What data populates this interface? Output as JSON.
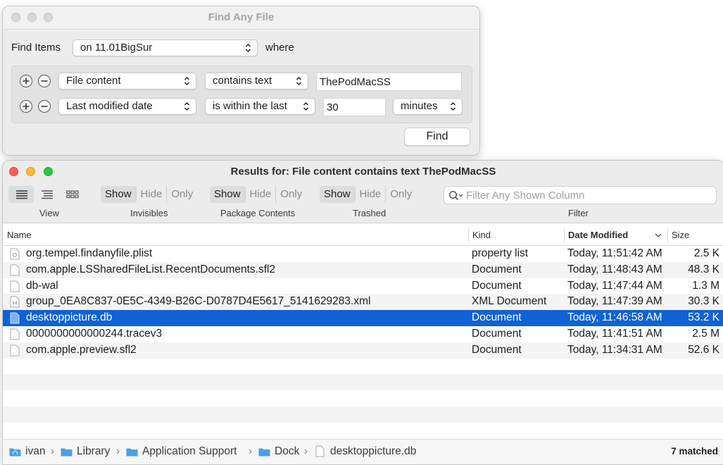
{
  "find_window": {
    "title": "Find Any File",
    "find_items_label": "Find Items",
    "location_value": "on 11.01BigSur",
    "where_label": "where",
    "criteria": [
      {
        "attribute": "File content",
        "operator": "contains text",
        "value": "ThePodMacSS"
      },
      {
        "attribute": "Last modified date",
        "operator": "is within the last",
        "value": "30",
        "unit": "minutes"
      }
    ],
    "find_button": "Find"
  },
  "results_window": {
    "title": "Results for: File content contains text ThePodMacSS",
    "toolbar": {
      "view_caption": "View",
      "groups": [
        {
          "caption": "Invisibles",
          "options": [
            "Show",
            "Hide",
            "Only"
          ],
          "selected": "Show"
        },
        {
          "caption": "Package Contents",
          "options": [
            "Show",
            "Hide",
            "Only"
          ],
          "selected": "Show"
        },
        {
          "caption": "Trashed",
          "options": [
            "Show",
            "Hide",
            "Only"
          ],
          "selected": "Show"
        }
      ],
      "filter_placeholder": "Filter Any Shown Column",
      "filter_caption": "Filter"
    },
    "columns": {
      "name": "Name",
      "kind": "Kind",
      "date": "Date Modified",
      "size": "Size"
    },
    "rows": [
      {
        "name": "org.tempel.findanyfile.plist",
        "kind": "property list",
        "date": "Today, 11:51:42 AM",
        "size": "2.5 K",
        "icon": "plist-file-icon"
      },
      {
        "name": "com.apple.LSSharedFileList.RecentDocuments.sfl2",
        "kind": "Document",
        "date": "Today, 11:48:43 AM",
        "size": "48.3 K",
        "icon": "document-icon"
      },
      {
        "name": "db-wal",
        "kind": "Document",
        "date": "Today, 11:47:44 AM",
        "size": "1.3 M",
        "icon": "document-icon"
      },
      {
        "name": "group_0EA8C837-0E5C-4349-B26C-D0787D4E5617_5141629283.xml",
        "kind": "XML Document",
        "date": "Today, 11:47:39 AM",
        "size": "30.3 K",
        "icon": "xml-file-icon"
      },
      {
        "name": "desktoppicture.db",
        "kind": "Document",
        "date": "Today, 11:46:58 AM",
        "size": "53.2 K",
        "icon": "document-icon"
      },
      {
        "name": "0000000000000244.tracev3",
        "kind": "Document",
        "date": "Today, 11:41:51 AM",
        "size": "2.5 M",
        "icon": "document-icon"
      },
      {
        "name": "com.apple.preview.sfl2",
        "kind": "Document",
        "date": "Today, 11:34:31 AM",
        "size": "52.6 K",
        "icon": "document-icon"
      }
    ],
    "selected_row": 4,
    "path_bar": [
      "ivan",
      "Library",
      "Application Support",
      "Dock",
      "desktoppicture.db"
    ],
    "match_count": "7 matched"
  },
  "colors": {
    "selection": "#0f62d6",
    "traffic_red": "#fe5f57",
    "traffic_yellow": "#febc2e",
    "traffic_green": "#28c840",
    "folder": "#4a9fe8"
  }
}
